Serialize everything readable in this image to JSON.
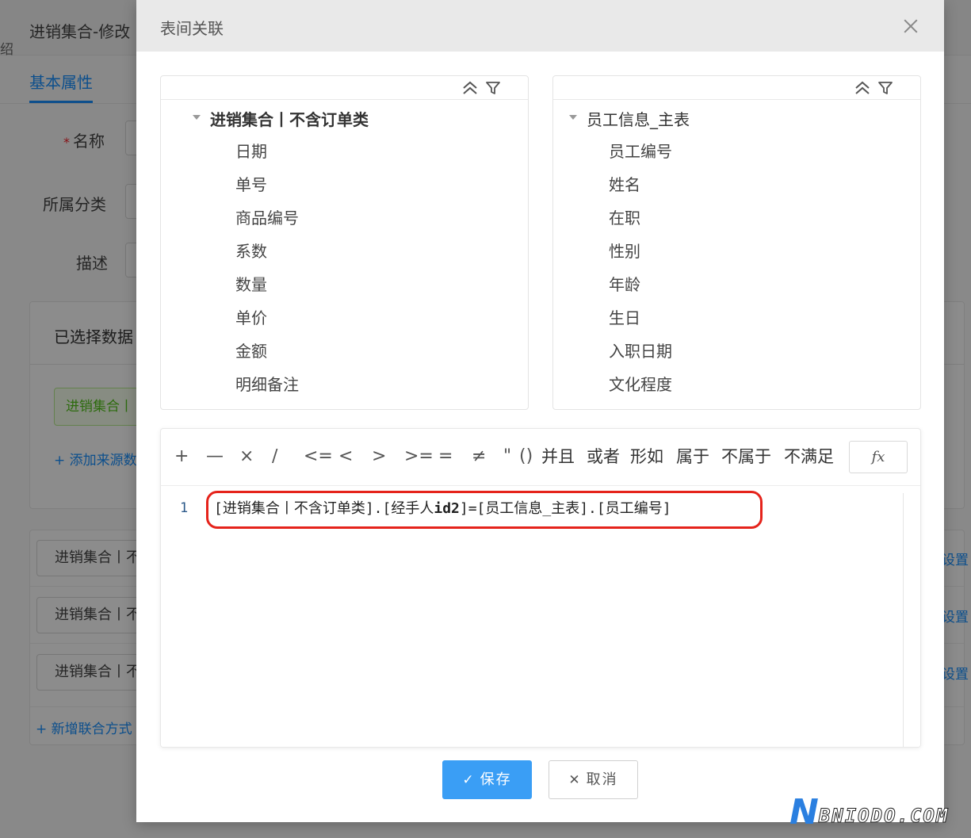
{
  "background": {
    "title": "进销集合-修改",
    "cut_char": "绍",
    "tab": "基本属性",
    "form_labels": {
      "name": "名称",
      "required_mark": "*",
      "category": "所属分类",
      "description": "描述"
    },
    "panel_title": "已选择数据",
    "green_tag": "进销集合丨",
    "add_source_link": "+ 添加来源数",
    "rows": [
      "进销集合丨不",
      "进销集合丨不",
      "进销集合丨不"
    ],
    "setting_link": "设置",
    "add_join_link": "+ 新增联合方式"
  },
  "modal": {
    "title": "表间关联",
    "left_tree": {
      "root": "进销集合丨不含订单类",
      "children": [
        "日期",
        "单号",
        "商品编号",
        "系数",
        "数量",
        "单价",
        "金额",
        "明细备注"
      ]
    },
    "right_tree": {
      "root": "员工信息_主表",
      "children": [
        "员工编号",
        "姓名",
        "在职",
        "性别",
        "年龄",
        "生日",
        "入职日期",
        "文化程度"
      ]
    },
    "operators": [
      "+",
      "—",
      "×",
      "∕",
      "<=",
      "<",
      ">",
      ">=",
      "=",
      "≠",
      "\"",
      "()",
      "并且",
      "或者",
      "形如",
      "属于",
      "不属于",
      "不满足"
    ],
    "fx_label": "fx",
    "editor": {
      "line_number": "1",
      "code_a": "[进销集合丨不含订单类].[经手人",
      "code_b": "id2",
      "code_c": "]=[员工信息_主表].[员工编号]",
      "highlight_color": "#e5231b"
    },
    "buttons": {
      "save": "保存",
      "save_icon": "✓",
      "cancel": "取消",
      "cancel_icon": "✕"
    },
    "accent_color": "#3a9ef5"
  },
  "watermark": {
    "letter": "N",
    "text": "BNIODO.COM"
  }
}
